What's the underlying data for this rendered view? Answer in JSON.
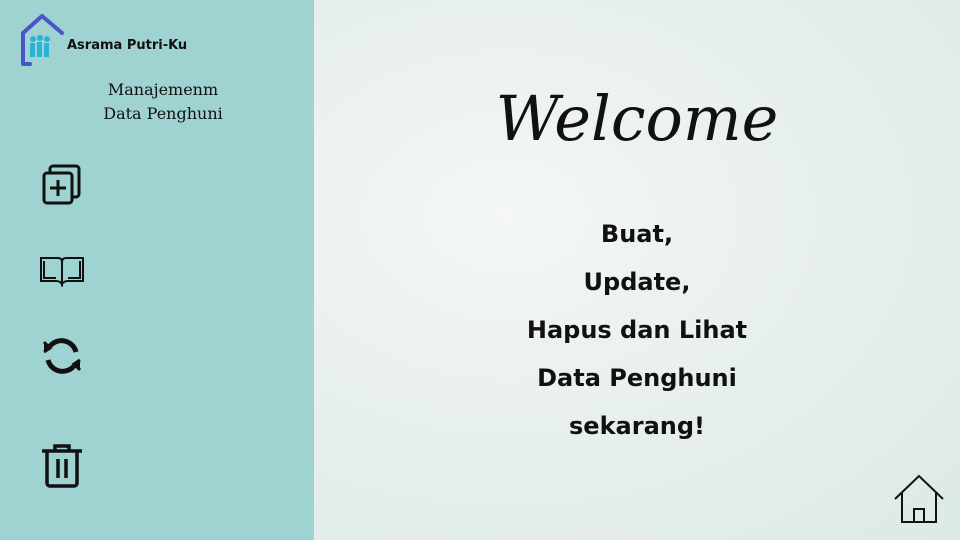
{
  "sidebar": {
    "brand": "Asrama Putri-Ku",
    "subtitle_line1": "Manajemenm",
    "subtitle_line2": "Data Penghuni",
    "items": [
      {
        "icon": "add-copy-icon"
      },
      {
        "icon": "book-icon"
      },
      {
        "icon": "refresh-icon"
      },
      {
        "icon": "trash-icon"
      }
    ]
  },
  "main": {
    "title": "Welcome",
    "lines": [
      "Buat,",
      "Update,",
      "Hapus dan Lihat",
      "Data Penghuni",
      "sekarang!"
    ],
    "home_icon": "home-icon"
  },
  "colors": {
    "sidebar": "#9fd3d1",
    "logo": "#4a56c8",
    "people": "#2ab5d6"
  }
}
